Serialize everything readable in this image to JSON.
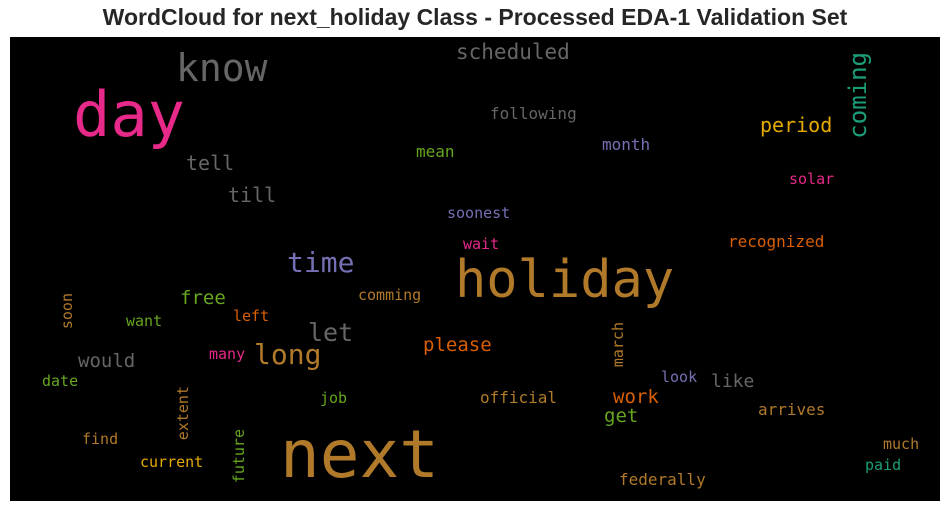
{
  "chart_data": {
    "type": "wordcloud",
    "title": "WordCloud for next_holiday Class - Processed EDA-1 Validation Set",
    "background": "#000000",
    "words": [
      {
        "text": "next",
        "color": "#b07a2a"
      },
      {
        "text": "holiday",
        "color": "#b07a2a"
      },
      {
        "text": "day",
        "color": "#e7298a"
      },
      {
        "text": "know",
        "color": "#666666"
      },
      {
        "text": "time",
        "color": "#7570b3"
      },
      {
        "text": "long",
        "color": "#b07a2a"
      },
      {
        "text": "coming",
        "color": "#1b9e77"
      },
      {
        "text": "let",
        "color": "#666666"
      },
      {
        "text": "scheduled",
        "color": "#666666"
      },
      {
        "text": "period",
        "color": "#e6ab02"
      },
      {
        "text": "tell",
        "color": "#666666"
      },
      {
        "text": "till",
        "color": "#666666"
      },
      {
        "text": "please",
        "color": "#d95f02"
      },
      {
        "text": "free",
        "color": "#66a61e"
      },
      {
        "text": "would",
        "color": "#666666"
      },
      {
        "text": "work",
        "color": "#d95f02"
      },
      {
        "text": "get",
        "color": "#66a61e"
      },
      {
        "text": "like",
        "color": "#666666"
      },
      {
        "text": "following",
        "color": "#666666"
      },
      {
        "text": "month",
        "color": "#7570b3"
      },
      {
        "text": "mean",
        "color": "#66a61e"
      },
      {
        "text": "solar",
        "color": "#e7298a"
      },
      {
        "text": "soonest",
        "color": "#7570b3"
      },
      {
        "text": "wait",
        "color": "#e7298a"
      },
      {
        "text": "recognized",
        "color": "#d95f02"
      },
      {
        "text": "comming",
        "color": "#b07a2a"
      },
      {
        "text": "soon",
        "color": "#b07a2a"
      },
      {
        "text": "want",
        "color": "#66a61e"
      },
      {
        "text": "left",
        "color": "#d95f02"
      },
      {
        "text": "many",
        "color": "#e7298a"
      },
      {
        "text": "march",
        "color": "#b07a2a"
      },
      {
        "text": "date",
        "color": "#66a61e"
      },
      {
        "text": "look",
        "color": "#7570b3"
      },
      {
        "text": "extent",
        "color": "#b07a2a"
      },
      {
        "text": "job",
        "color": "#66a61e"
      },
      {
        "text": "official",
        "color": "#b07a2a"
      },
      {
        "text": "arrives",
        "color": "#b07a2a"
      },
      {
        "text": "find",
        "color": "#b07a2a"
      },
      {
        "text": "future",
        "color": "#66a61e"
      },
      {
        "text": "current",
        "color": "#e6ab02"
      },
      {
        "text": "federally",
        "color": "#b07a2a"
      },
      {
        "text": "much",
        "color": "#b07a2a"
      },
      {
        "text": "paid",
        "color": "#1b9e77"
      }
    ]
  }
}
